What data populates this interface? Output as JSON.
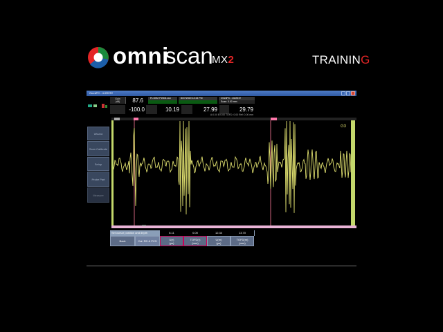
{
  "brand": {
    "omni": "omni",
    "scan": "scan",
    "model": "MX",
    "model_num": "2",
    "training_prefix": "TRAININ",
    "training_suffix": "G",
    "accent": "#e32526"
  },
  "window": {
    "title": "OmniPC - 4.0R3T2"
  },
  "header": {
    "gain_label": "Gain\n(dB)",
    "gain": "87.6",
    "row2_values": [
      "-100.0",
      "10.19",
      "27.99",
      "29.79"
    ],
    "info_1": "FL10S2 P2304.oux",
    "info_2": "8/27/2020 12:44 PM",
    "info_3": "OmniPC - LM2372",
    "info_4": "Scan: 0.00 mm",
    "gate_line": "A:0.00 B:0.00 TOFD: 0.00 Ref: 0.00 mm"
  },
  "side_menu": [
    "Wizard",
    "Scan Calibrate",
    "Setup",
    "Probe Part",
    "Measure"
  ],
  "ascan": {
    "label_g3": "G3",
    "trace_color": "#dede6e",
    "cursor_color": "#ff7b9c"
  },
  "bottom": {
    "prompt": "Set cursor position and depth",
    "back_label": "Back",
    "cal_label": "Cal. RD & PCS",
    "fields": [
      {
        "value": "8.11",
        "label": "U(r)\n(µs)"
      },
      {
        "value": "0.00",
        "label": "TOFD(r)\n(mm)"
      },
      {
        "value": "12.34",
        "label": "U(m)\n(µs)"
      },
      {
        "value": "13.70",
        "label": "TOFD(m)\n(mm)"
      }
    ]
  }
}
